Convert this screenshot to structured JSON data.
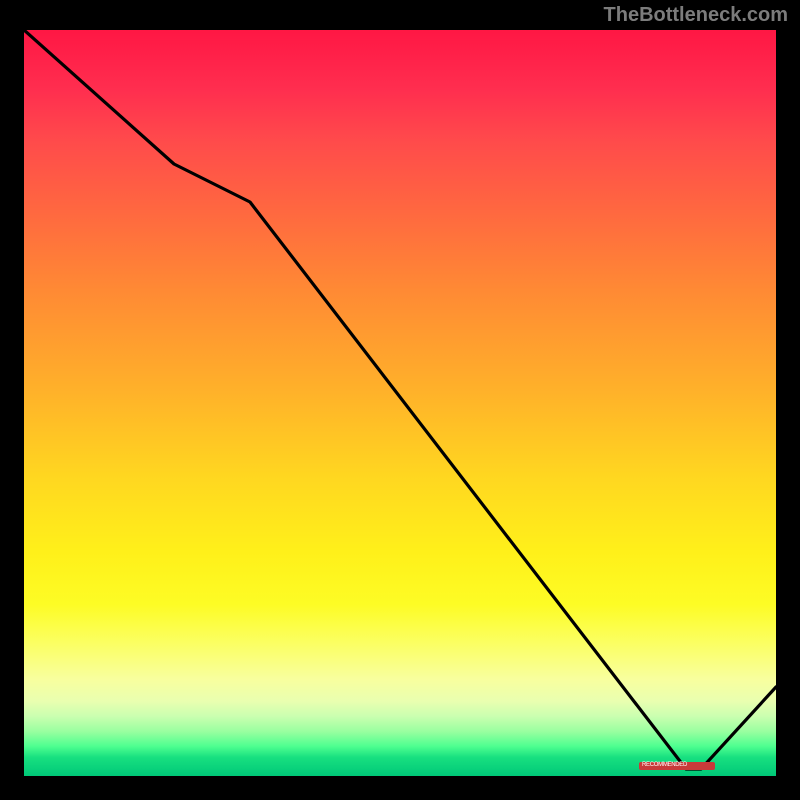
{
  "attribution": "TheBottleneck.com",
  "chart_data": {
    "type": "line",
    "title": "",
    "xlabel": "",
    "ylabel": "",
    "xlim": [
      0,
      100
    ],
    "ylim": [
      0,
      100
    ],
    "grid": false,
    "series": [
      {
        "name": "bottleneck-curve",
        "x": [
          0,
          20,
          30,
          88,
          90,
          100
        ],
        "values": [
          100,
          82,
          77,
          1,
          1,
          12
        ]
      }
    ],
    "annotations": [
      {
        "label": "RECOMMENDED",
        "x_start": 82,
        "x_end": 92,
        "y": 1
      }
    ],
    "background": {
      "type": "vertical-gradient",
      "stops": [
        {
          "pct": 0,
          "color": "#ff1744"
        },
        {
          "pct": 50,
          "color": "#ffc726"
        },
        {
          "pct": 80,
          "color": "#fcff40"
        },
        {
          "pct": 100,
          "color": "#00c878"
        }
      ]
    }
  }
}
